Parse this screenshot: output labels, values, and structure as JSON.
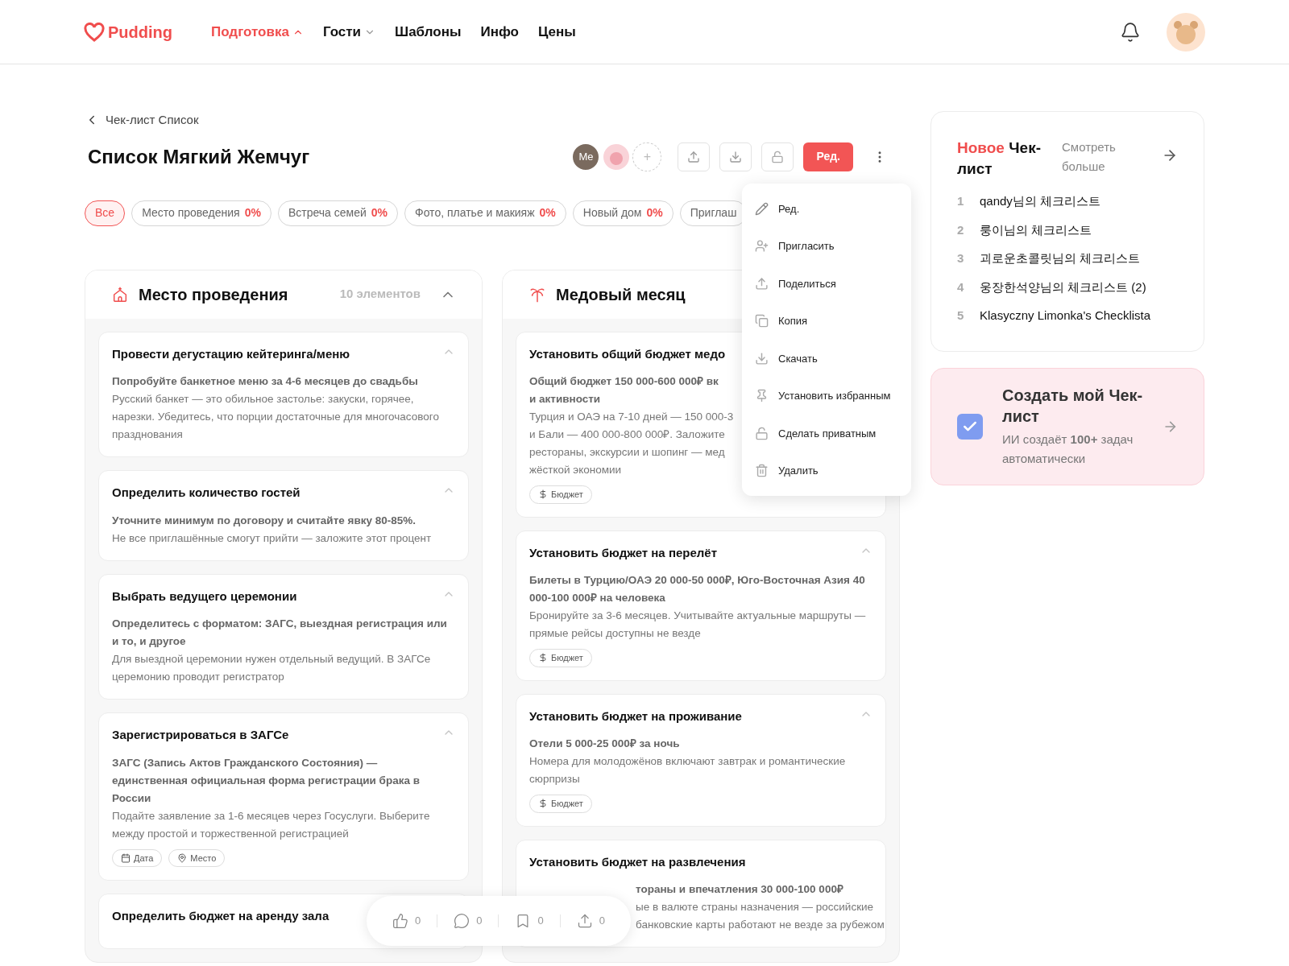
{
  "header": {
    "logo": "Pudding",
    "nav": [
      {
        "label": "Подготовка",
        "selected": true,
        "expanded": true
      },
      {
        "label": "Гости",
        "selected": false,
        "expanded": false
      },
      {
        "label": "Шаблоны",
        "selected": false
      },
      {
        "label": "Инфо",
        "selected": false
      },
      {
        "label": "Цены",
        "selected": false
      }
    ]
  },
  "breadcrumb": "Чек-лист Список",
  "title": "Список Мягкий Жемчуг",
  "collaborators": [
    {
      "kind": "initials",
      "label": "Me"
    },
    {
      "kind": "avatar"
    },
    {
      "kind": "add",
      "label": "+"
    }
  ],
  "edit_button": "Ред.",
  "filters": [
    {
      "label": "Все",
      "selected": true
    },
    {
      "label": "Место проведения",
      "percent": "0%",
      "selected": false
    },
    {
      "label": "Встреча семей",
      "percent": "0%",
      "selected": false
    },
    {
      "label": "Фото, платье и макияж",
      "percent": "0%",
      "selected": false
    },
    {
      "label": "Новый дом",
      "percent": "0%",
      "selected": false
    },
    {
      "label": "Приглаш",
      "selected": false
    }
  ],
  "menu": [
    {
      "kind": "edit",
      "label": "Ред."
    },
    {
      "kind": "invite",
      "label": "Пригласить"
    },
    {
      "kind": "share",
      "label": "Поделиться"
    },
    {
      "kind": "copy",
      "label": "Копия"
    },
    {
      "kind": "download",
      "label": "Скачать"
    },
    {
      "kind": "pin",
      "label": "Установить избранным"
    },
    {
      "kind": "lock",
      "label": "Сделать приватным"
    },
    {
      "kind": "delete",
      "label": "Удалить"
    }
  ],
  "columns": [
    {
      "kind": "venue",
      "title": "Место проведения",
      "count": "10 элементов",
      "cards": [
        {
          "title": "Провести дегустацию кейтеринга/меню",
          "lead": "Попробуйте банкетное меню за 4-6 месяцев до свадьбы",
          "body": "Русский банкет — это обильное застолье: закуски, горячее, нарезки. Убедитесь, что порции достаточные для многочасового празднования"
        },
        {
          "title": "Определить количество гостей",
          "lead": "Уточните минимум по договору и считайте явку 80-85%.",
          "body": "Не все приглашённые смогут прийти — заложите этот процент"
        },
        {
          "title": "Выбрать ведущего церемонии",
          "lead": "Определитесь с форматом: ЗАГС, выездная регистрация или и то, и другое",
          "body": "Для выездной церемонии нужен отдельный ведущий. В ЗАГСе церемонию проводит регистратор"
        },
        {
          "title": "Зарегистрироваться в ЗАГСе",
          "lead": "ЗАГС (Запись Актов Гражданского Состояния) — единственная официальная форма регистрации брака в России",
          "body": "Подайте заявление за 1-6 месяцев через Госуслуги. Выберите между простой и торжественной регистрацией",
          "tags": [
            {
              "kind": "date",
              "label": "Дата"
            },
            {
              "kind": "place",
              "label": "Место"
            }
          ]
        },
        {
          "title": "Определить бюджет на аренду зала"
        }
      ]
    },
    {
      "kind": "honeymoon",
      "title": "Медовый месяц",
      "cards": [
        {
          "title": "Установить общий бюджет медо",
          "lead": [
            "Общий бюджет 150 000-600 000₽ вк",
            "и активности"
          ],
          "body": [
            "Турция и ОАЭ на 7-10 дней — 150 000-3",
            "и Бали — 400 000-800 000₽. Заложите",
            "рестораны, экскурсии и шопинг — мед",
            "жёсткой экономии"
          ],
          "tags": [
            {
              "kind": "budget",
              "label": "Бюджет"
            }
          ]
        },
        {
          "title": "Установить бюджет на перелёт",
          "lead": "Билеты в Турцию/ОАЭ 20 000-50 000₽, Юго-Восточная Азия 40 000-100 000₽ на человека",
          "body": "Бронируйте за 3-6 месяцев. Учитывайте актуальные маршруты — прямые рейсы доступны не везде",
          "tags": [
            {
              "kind": "budget",
              "label": "Бюджет"
            }
          ]
        },
        {
          "title": "Установить бюджет на проживание",
          "lead": "Отели 5 000-25 000₽ за ночь",
          "body": "Номера для молодожёнов включают завтрак и романтические сюрпризы",
          "tags": [
            {
              "kind": "budget",
              "label": "Бюджет"
            }
          ]
        },
        {
          "title": "Установить бюджет на развлечения",
          "lead": [
            "тораны и впечатления 30 000-100 000₽"
          ],
          "body": [
            "ые в валюте страны назначения — российские",
            "банковские карты работают не везде за рубежом"
          ],
          "indent": true
        }
      ]
    }
  ],
  "actions": [
    {
      "kind": "like",
      "count": "0"
    },
    {
      "kind": "comment",
      "count": "0"
    },
    {
      "kind": "bookmark",
      "count": "0"
    },
    {
      "kind": "share",
      "count": "0"
    }
  ],
  "new_checklists": {
    "title_accent": "Новое",
    "title": "Чек-лист",
    "more": "Смотреть больше",
    "items": [
      {
        "rank": "1",
        "name": "qandy님의 체크리스트"
      },
      {
        "rank": "2",
        "name": "룽이님의 체크리스트"
      },
      {
        "rank": "3",
        "name": "괴로운초콜릿님의 체크리스트"
      },
      {
        "rank": "4",
        "name": "웅장한석양님의 체크리스트 (2)"
      },
      {
        "rank": "5",
        "name": "Klasyczny Limonka's Checklista"
      }
    ]
  },
  "create": {
    "title": "Создать мой Чек-лист",
    "subtitle": "ИИ создаёт **100+** задач автоматически"
  }
}
